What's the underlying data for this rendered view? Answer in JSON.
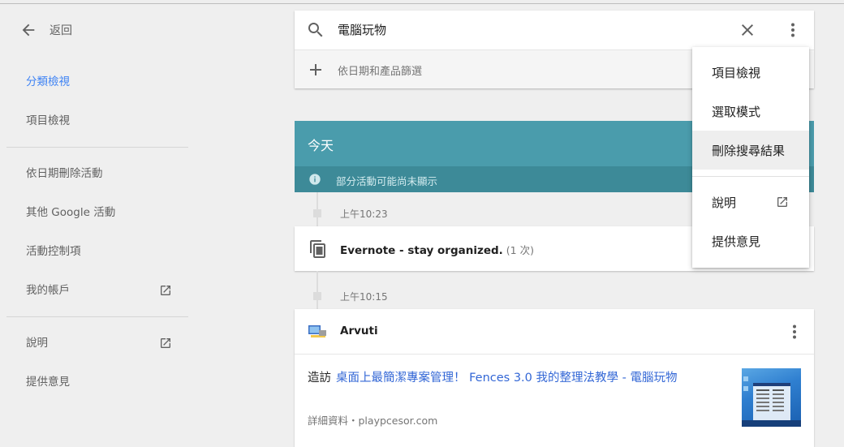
{
  "sidebar": {
    "back_label": "返回",
    "items": [
      {
        "label": "分類檢視",
        "active": true
      },
      {
        "label": "項目檢視"
      },
      {
        "label": "依日期刪除活動"
      },
      {
        "label": "其他 Google 活動"
      },
      {
        "label": "活動控制項"
      },
      {
        "label": "我的帳戶",
        "icon": "open-in-new-icon"
      },
      {
        "label": "說明",
        "icon": "open-in-new-icon"
      },
      {
        "label": "提供意見"
      }
    ]
  },
  "search": {
    "query": "電腦玩物",
    "filter_label": "依日期和產品篩選"
  },
  "today": {
    "title": "今天",
    "note": "部分活動可能尚未顯示",
    "header_color": "#4a9cac"
  },
  "timeline": [
    {
      "time": "上午10:23",
      "title": "Evernote - stay organized.",
      "count": "(1 次)"
    },
    {
      "time": "上午10:15",
      "app": "Arvuti",
      "visit_prefix": "造訪",
      "link_text": "桌面上最簡潔專案管理！ Fences 3.0 我的整理法教學 - 電腦玩物",
      "meta": "詳細資料・playpcesor.com"
    }
  ],
  "menu": {
    "items": [
      {
        "label": "項目檢視"
      },
      {
        "label": "選取模式"
      },
      {
        "label": "刪除搜尋結果",
        "highlighted": true
      },
      {
        "label": "說明",
        "icon": "open-in-new-icon"
      },
      {
        "label": "提供意見"
      }
    ]
  },
  "colors": {
    "accent": "#4285f4",
    "link": "#3367d6"
  }
}
